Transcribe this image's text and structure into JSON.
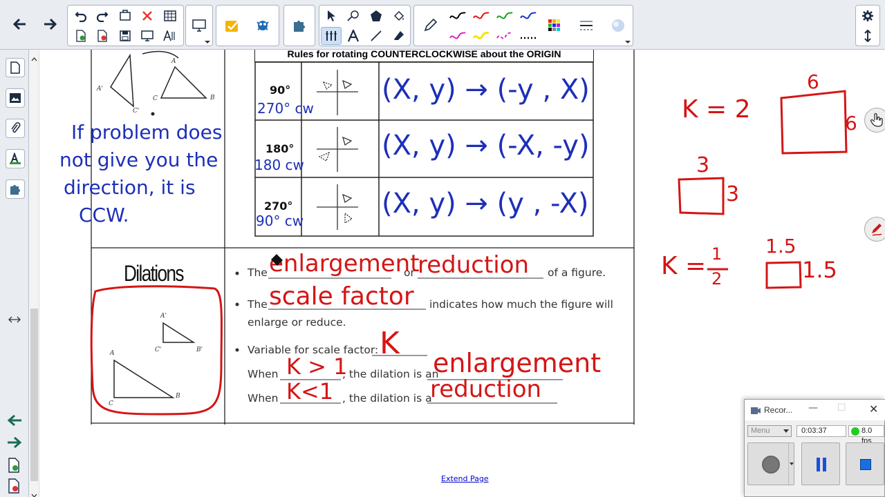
{
  "toolbar": {
    "groups": [
      "history-group",
      "display-group",
      "addons-group",
      "tools-group",
      "pens-group",
      "settings-group"
    ]
  },
  "worksheet": {
    "rotation_table": {
      "header": "Rules for rotating COUNTERCLOCKWISE about the ORIGIN",
      "rows": [
        {
          "deg": "90°",
          "cw_note": "270° cw",
          "rule": "(X, y) → (-y , X)"
        },
        {
          "deg": "180°",
          "cw_note": "180 cw",
          "rule": "(X, y) → (-X, -y)"
        },
        {
          "deg": "270°",
          "cw_note": "90° cw",
          "rule": "(X, y) → (y , -X)"
        }
      ]
    },
    "left_note": [
      "If problem does",
      "not give you the",
      "direction, it is",
      "CCW."
    ],
    "dilations": {
      "title": "Dilations",
      "line1": {
        "prefix": "The",
        "blank1": "enlargement",
        "mid": "or",
        "blank2": "reduction",
        "suffix": "of a figure."
      },
      "line2": {
        "prefix": "The",
        "blank": "scale factor",
        "suffix": "indicates how much the figure will",
        "line2b": "enlarge or reduce."
      },
      "line3": {
        "prefix": "Variable for scale factor:",
        "blank": "K"
      },
      "line4": {
        "prefix": "When",
        "blank1": "K > 1",
        "mid": ", the dilation is an",
        "blank2": "enlargement"
      },
      "line5": {
        "prefix": "When",
        "blank1": "K<1",
        "mid": ", the dilation is a",
        "blank2": "reduction"
      },
      "labels": [
        "A'",
        "C'",
        "B'",
        "A",
        "C",
        "B"
      ]
    },
    "rotation_labels": [
      "A'",
      "C'",
      "A",
      "B",
      "C"
    ]
  },
  "annotations": {
    "k2": "K = 2",
    "big_top": "6",
    "big_side": "6",
    "small_top": "3",
    "small_side": "3",
    "k_half_prefix": "K =",
    "k_half_num": "1",
    "k_half_den": "2",
    "tiny_top": "1.5",
    "tiny_side": "1.5"
  },
  "extend_page": "Extend Page",
  "recorder": {
    "title": "Recor...",
    "menu": "Menu",
    "time": "0:03:37",
    "fps": "8.0 fps",
    "status_color": "#22cc22"
  }
}
